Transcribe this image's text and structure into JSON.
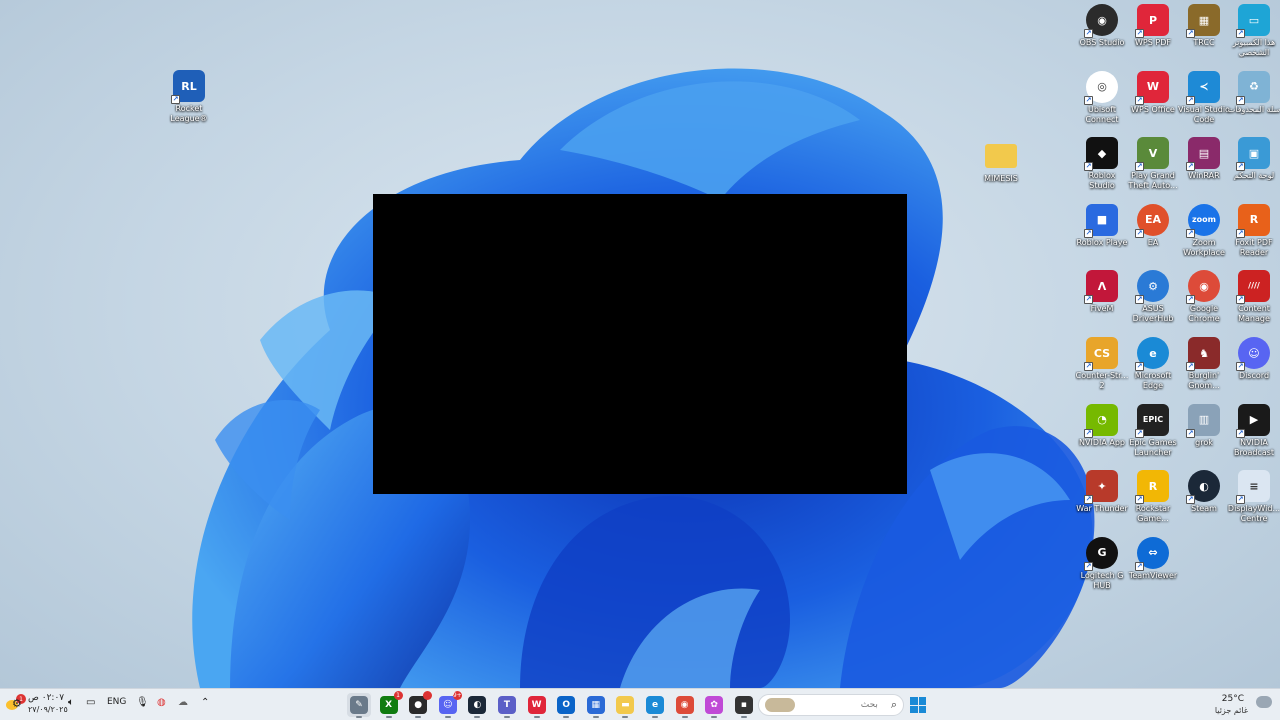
{
  "desktop": {
    "left_icons": [
      {
        "label": "Rocket League®",
        "color": "#1f5fb8",
        "glyph": "RL",
        "icon": "rocket-league-icon"
      }
    ],
    "folder": {
      "label": "MIMESIS",
      "color": "#f2c94c",
      "icon": "folder-icon"
    },
    "right_icons": [
      {
        "label": "OBS Studio",
        "color": "#2b2b2b",
        "glyph": "◉",
        "icon": "obs-studio-icon",
        "round": true
      },
      {
        "label": "WPS PDF",
        "color": "#e0263a",
        "glyph": "P",
        "icon": "wps-pdf-icon"
      },
      {
        "label": "TRCC",
        "color": "#8a6a2a",
        "glyph": "▦",
        "icon": "trcc-icon"
      },
      {
        "label": "هذا الكمبيوتر الشخصي",
        "color": "#1ea5d6",
        "glyph": "▭",
        "icon": "this-pc-icon"
      },
      {
        "label": "Ubisoft Connect",
        "color": "#ffffff",
        "glyph": "◎",
        "icon": "ubisoft-connect-icon",
        "round": true,
        "dark": true
      },
      {
        "label": "WPS Office",
        "color": "#e0263a",
        "glyph": "W",
        "icon": "wps-office-icon"
      },
      {
        "label": "Visual Studio Code",
        "color": "#1e8ad6",
        "glyph": "≺",
        "icon": "vscode-icon"
      },
      {
        "label": "سلة المحذوفات",
        "color": "#7fb3d5",
        "glyph": "♻",
        "icon": "recycle-bin-icon"
      },
      {
        "label": "Roblox Studio",
        "color": "#111111",
        "glyph": "◆",
        "icon": "roblox-studio-icon"
      },
      {
        "label": "Play Grand Theft Auto...",
        "color": "#5a8a3a",
        "glyph": "V",
        "icon": "gta-v-icon"
      },
      {
        "label": "WinRAR",
        "color": "#8a2a6a",
        "glyph": "▤",
        "icon": "winrar-icon"
      },
      {
        "label": "لوحة التحكم",
        "color": "#3a9ad6",
        "glyph": "▣",
        "icon": "control-panel-icon"
      },
      {
        "label": "Roblox Playe",
        "color": "#2a6ae0",
        "glyph": "■",
        "icon": "roblox-player-icon"
      },
      {
        "label": "EA",
        "color": "#e0502a",
        "glyph": "EA",
        "icon": "ea-icon",
        "round": true
      },
      {
        "label": "Zoom Workplace",
        "color": "#1a73e8",
        "glyph": "zoom",
        "icon": "zoom-icon",
        "round": true
      },
      {
        "label": "Foxit PDF Reader",
        "color": "#e8611a",
        "glyph": "R",
        "icon": "foxit-reader-icon"
      },
      {
        "label": "FiveM",
        "color": "#c2173a",
        "glyph": "Λ",
        "icon": "fivem-icon"
      },
      {
        "label": "ASUS DriverHub",
        "color": "#2a7ad6",
        "glyph": "⚙",
        "icon": "asus-driverhub-icon",
        "round": true
      },
      {
        "label": "Google Chrome",
        "color": "#dd4b39",
        "glyph": "◉",
        "icon": "chrome-icon",
        "round": true
      },
      {
        "label": "Content Manage",
        "color": "#cc2222",
        "glyph": "////",
        "icon": "content-manager-icon"
      },
      {
        "label": "Counter-Str... 2",
        "color": "#e8a52a",
        "glyph": "CS",
        "icon": "counter-strike-icon"
      },
      {
        "label": "Microsoft Edge",
        "color": "#1a8ad6",
        "glyph": "e",
        "icon": "edge-icon",
        "round": true
      },
      {
        "label": "Burglin' Gnom...",
        "color": "#8a2a2a",
        "glyph": "♞",
        "icon": "burglin-gnomes-icon"
      },
      {
        "label": "Discord",
        "color": "#5865f2",
        "glyph": "☺",
        "icon": "discord-icon",
        "round": true
      },
      {
        "label": "NVIDIA App",
        "color": "#76b900",
        "glyph": "◔",
        "icon": "nvidia-app-icon"
      },
      {
        "label": "Epic Games Launcher",
        "color": "#222222",
        "glyph": "EPIC",
        "icon": "epic-games-icon"
      },
      {
        "label": "grok",
        "color": "#8aa2b8",
        "glyph": "▥",
        "icon": "grok-icon"
      },
      {
        "label": "NVIDIA Broadcast",
        "color": "#1a1a1a",
        "glyph": "▶",
        "icon": "nvidia-broadcast-icon"
      },
      {
        "label": "War Thunder",
        "color": "#b83a2a",
        "glyph": "✦",
        "icon": "war-thunder-icon"
      },
      {
        "label": "Rockstar Game...",
        "color": "#f2b705",
        "glyph": "R",
        "icon": "rockstar-launcher-icon"
      },
      {
        "label": "Steam",
        "color": "#1b2838",
        "glyph": "◐",
        "icon": "steam-icon",
        "round": true
      },
      {
        "label": "DisplayWid... Centre",
        "color": "#dbe6f2",
        "glyph": "≡",
        "icon": "displaywidget-icon",
        "dark": true
      },
      {
        "label": "Logitech G HUB",
        "color": "#111111",
        "glyph": "G",
        "icon": "logitech-ghub-icon",
        "round": true
      },
      {
        "label": "TeamViewer",
        "color": "#0e6bd6",
        "glyph": "⇔",
        "icon": "teamviewer-icon",
        "round": true
      }
    ]
  },
  "taskbar": {
    "apps": [
      {
        "name": "taskbar-paint-app",
        "color": "#6a7a8a",
        "glyph": "✎",
        "active": true
      },
      {
        "name": "taskbar-xbox",
        "color": "#107c10",
        "glyph": "X",
        "badge": "1"
      },
      {
        "name": "taskbar-app-dark",
        "color": "#2a2a2a",
        "glyph": "●",
        "badge": ""
      },
      {
        "name": "taskbar-discord",
        "color": "#5865f2",
        "glyph": "☺",
        "badge": "9+"
      },
      {
        "name": "taskbar-steam",
        "color": "#1b2838",
        "glyph": "◐"
      },
      {
        "name": "taskbar-teams",
        "color": "#5b5fc7",
        "glyph": "T"
      },
      {
        "name": "taskbar-wps",
        "color": "#e0263a",
        "glyph": "W"
      },
      {
        "name": "taskbar-outlook",
        "color": "#0a64c8",
        "glyph": "O"
      },
      {
        "name": "taskbar-store",
        "color": "#2a6ad6",
        "glyph": "▦"
      },
      {
        "name": "taskbar-file-explorer",
        "color": "#f2c94c",
        "glyph": "▬"
      },
      {
        "name": "taskbar-edge",
        "color": "#1a8ad6",
        "glyph": "e"
      },
      {
        "name": "taskbar-chrome",
        "color": "#dd4b39",
        "glyph": "◉"
      },
      {
        "name": "taskbar-copilot",
        "color": "#c04ad6",
        "glyph": "✿"
      },
      {
        "name": "taskbar-terminal",
        "color": "#333333",
        "glyph": "▪"
      }
    ],
    "search_placeholder": "بحث",
    "weather": {
      "temp": "25°C",
      "desc": "غائم جزئيا",
      "alert": "1"
    },
    "tray": {
      "language": "ENG",
      "time": "٠٢:٠٧ ص",
      "date": "٢٧/٠٩/٢٠٢٥"
    }
  }
}
